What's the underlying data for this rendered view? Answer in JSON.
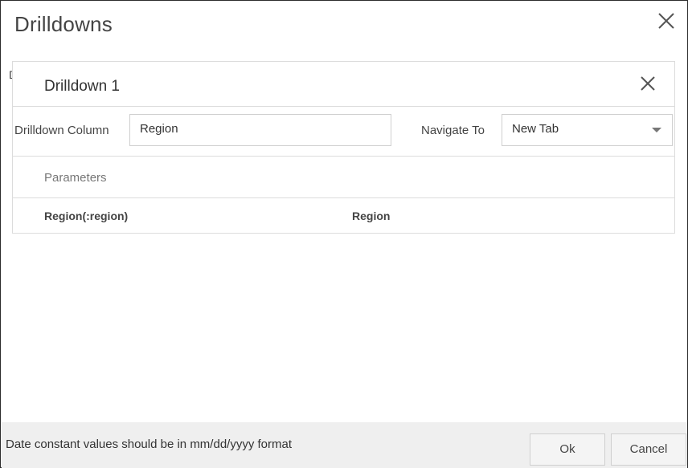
{
  "dialog": {
    "title": "Drilldowns",
    "partial_hidden_text": "D"
  },
  "drilldown": {
    "title": "Drilldown 1",
    "column_label": "Drilldown Column",
    "column_value": "Region",
    "navigate_label": "Navigate To",
    "navigate_value": "New Tab"
  },
  "parameters": {
    "title": "Parameters",
    "rows": [
      {
        "name": "Region(:region)",
        "value": "Region"
      }
    ]
  },
  "footer": {
    "note": "Date constant values should be in mm/dd/yyyy format",
    "ok_label": "Ok",
    "cancel_label": "Cancel"
  },
  "icons": {
    "dialog_close": "close-icon",
    "panel_close": "close-icon",
    "select_caret": "chevron-down-icon"
  },
  "colors": {
    "border": "#dcdcdc",
    "footer_bg": "#efefef",
    "text": "#333333"
  }
}
